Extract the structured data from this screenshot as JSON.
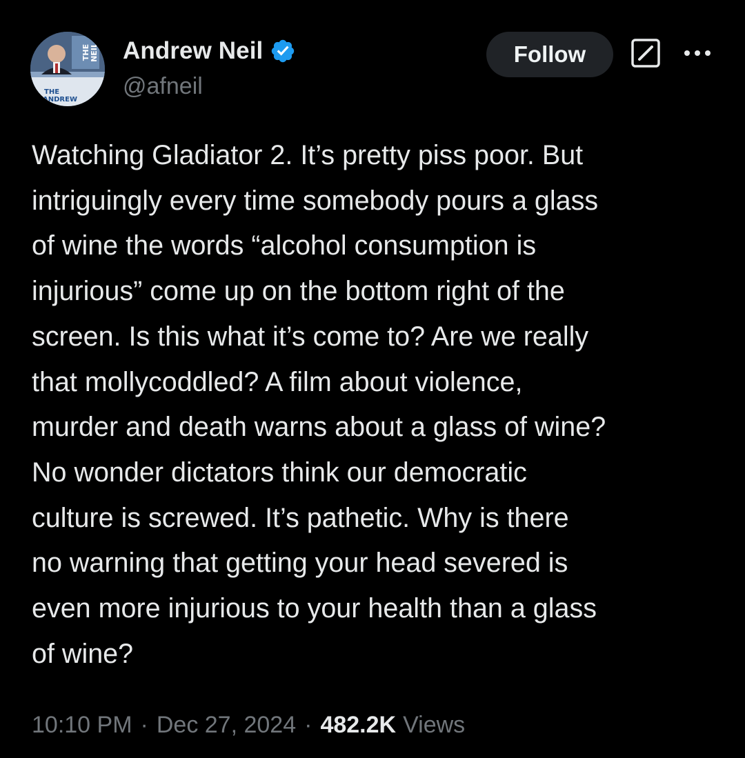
{
  "author": {
    "display_name": "Andrew Neil",
    "handle": "@afneil",
    "avatar_text_top": "THE NEIL",
    "avatar_text_bottom": "THE ANDREW"
  },
  "actions": {
    "follow_label": "Follow"
  },
  "tweet": {
    "text": "Watching Gladiator 2. It’s pretty piss poor. But\nintriguingly every time somebody pours a glass\nof wine the words “alcohol consumption is\ninjurious” come up on the bottom right of the\nscreen. Is this what it’s come to? Are we really\nthat mollycoddled? A film about violence,\nmurder and death warns about a glass of wine?\nNo wonder dictators think our democratic\nculture is screwed. It’s pathetic. Why is there\nno warning that getting your head severed is\neven more injurious to your health than a glass\nof wine?"
  },
  "meta": {
    "time": "10:10 PM",
    "separator": "·",
    "date": "Dec 27, 2024",
    "views_count": "482.2K",
    "views_label": "Views"
  },
  "colors": {
    "background": "#000000",
    "text_primary": "#e7e9ea",
    "text_secondary": "#71767b",
    "verified_blue": "#1d9bf0",
    "button_bg": "#202327"
  },
  "icons": {
    "verified": "verified-badge-icon",
    "grok": "grok-icon",
    "more": "more-options-icon"
  }
}
